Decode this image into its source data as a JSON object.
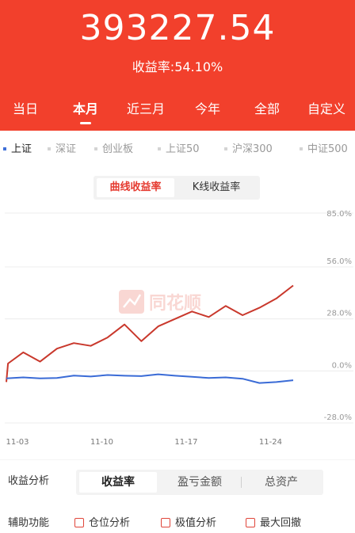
{
  "header": {
    "total_value": "393227.54",
    "rate_label": "收益率:",
    "rate_value": "54.10%",
    "background_color": "#f2402c"
  },
  "period_tabs": [
    {
      "label": "当日",
      "active": false
    },
    {
      "label": "本月",
      "active": true
    },
    {
      "label": "近三月",
      "active": false
    },
    {
      "label": "今年",
      "active": false
    },
    {
      "label": "全部",
      "active": false
    },
    {
      "label": "自定义",
      "active": false
    }
  ],
  "index_tabs": [
    {
      "label": "上证",
      "active": true
    },
    {
      "label": "深证",
      "active": false
    },
    {
      "label": "创业板",
      "active": false
    },
    {
      "label": "上证50",
      "active": false
    },
    {
      "label": "沪深300",
      "active": false
    },
    {
      "label": "中证500",
      "active": false
    }
  ],
  "chart_toggle": {
    "active_label": "曲线收益率",
    "inactive_label": "K线收益率"
  },
  "watermark": "同花顺",
  "chart_data": {
    "type": "line",
    "x_tick_labels": [
      "11-03",
      "11-10",
      "11-17",
      "11-24"
    ],
    "x_ticks_at": [
      0,
      5,
      10,
      15
    ],
    "y_tick_labels": [
      "85.0%",
      "56.0%",
      "28.0%",
      "0.0%",
      "-28.0%"
    ],
    "y_ticks": [
      85.0,
      56.0,
      28.0,
      0.0,
      -28.0
    ],
    "ylim": [
      -28.0,
      85.0
    ],
    "xlim": [
      0,
      17
    ],
    "grid": true,
    "series": [
      {
        "color": "#c9382c",
        "x": [
          0,
          0.1,
          1,
          2,
          3,
          4,
          5,
          6,
          7,
          8,
          9,
          10,
          11,
          12,
          13,
          14,
          15,
          16,
          17
        ],
        "values": [
          -6.0,
          4.0,
          10.0,
          5.0,
          12.0,
          15.0,
          13.5,
          18.0,
          25.0,
          16.0,
          24.0,
          28.0,
          32.0,
          29.0,
          35.0,
          30.0,
          34.0,
          39.0,
          46.0
        ]
      },
      {
        "color": "#3a6bd6",
        "x": [
          0,
          1,
          2,
          3,
          4,
          5,
          6,
          7,
          8,
          9,
          10,
          11,
          12,
          13,
          14,
          15,
          16,
          17
        ],
        "values": [
          -4.0,
          -3.5,
          -4.0,
          -3.8,
          -2.5,
          -3.0,
          -2.2,
          -2.6,
          -2.8,
          -1.8,
          -2.6,
          -3.2,
          -3.8,
          -3.5,
          -4.2,
          -6.5,
          -6.0,
          -5.0
        ]
      }
    ]
  },
  "analysis": {
    "label": "收益分析",
    "tabs": [
      {
        "label": "收益率",
        "active": true
      },
      {
        "label": "盈亏金额",
        "active": false
      },
      {
        "label": "总资产",
        "active": false
      }
    ]
  },
  "aux": {
    "label": "辅助功能",
    "options": [
      "仓位分析",
      "极值分析",
      "最大回撤"
    ]
  }
}
